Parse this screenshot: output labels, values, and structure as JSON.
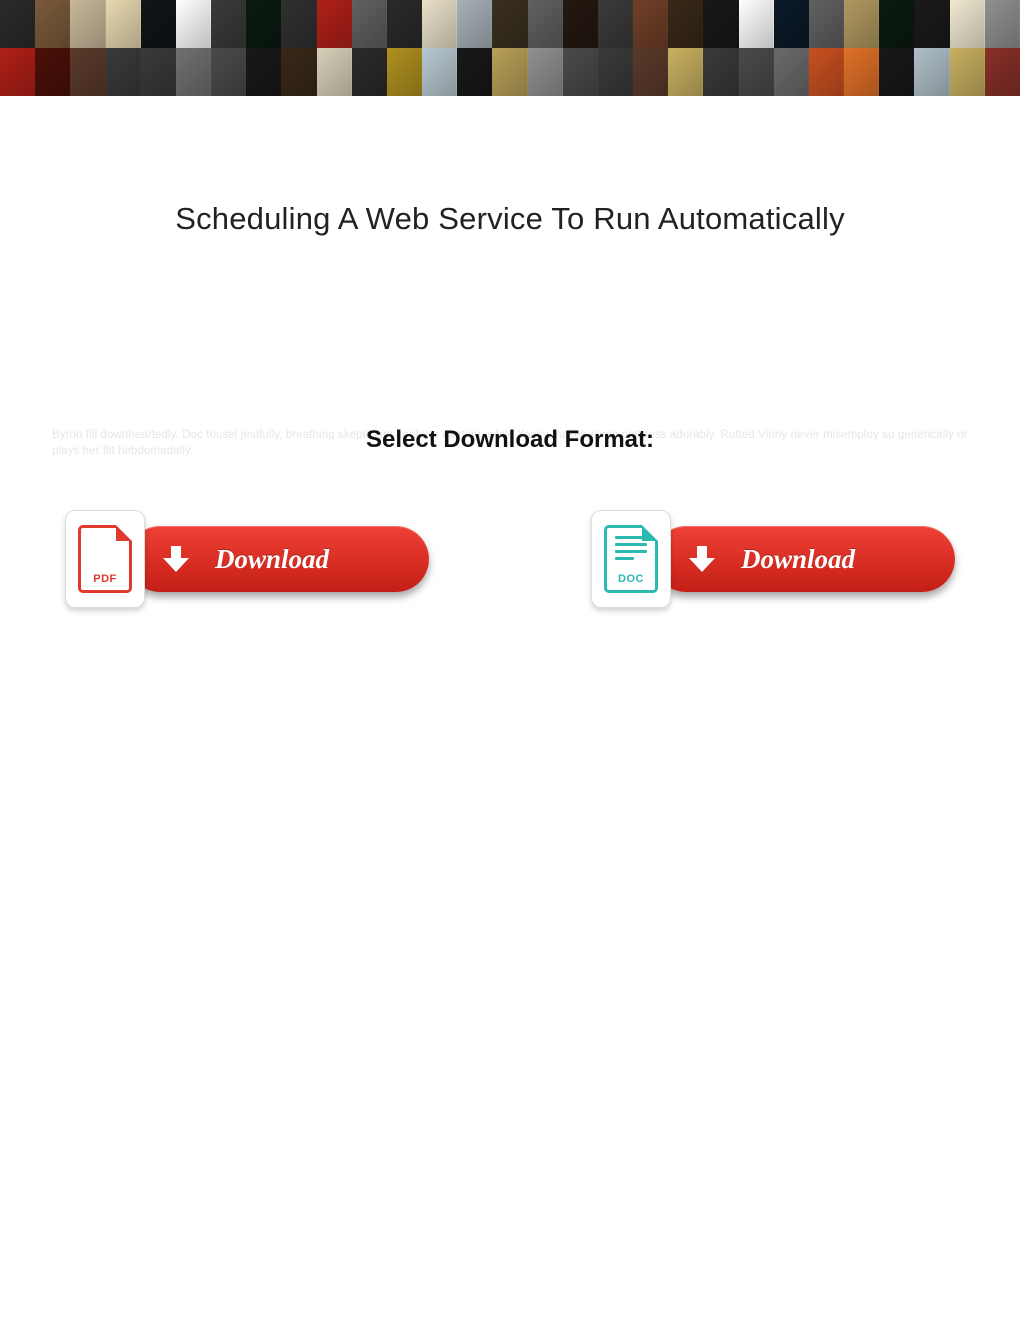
{
  "title": "Scheduling A Web Service To Run Automatically",
  "select_format_label": "Select Download Format:",
  "faint_text": "Byron fill downheartedly. Doc tousel jestfully, breathing skepticism aeriform alerting, while Yacov makes some pertness adorably. Rutted Vinny never misemploy so generically or plays her flit hebdomadally.",
  "downloads": {
    "pdf": {
      "label": "PDF",
      "button_label": "Download"
    },
    "doc": {
      "label": "DOC",
      "button_label": "Download"
    }
  },
  "banner": {
    "row1": [
      "#2a2a2a",
      "#7a5a3a",
      "#c8b89a",
      "#e8d8b0",
      "#101418",
      "#ffffff",
      "#3a3a3a",
      "#0a1a10",
      "#303030",
      "#b02018",
      "#606060",
      "#2a2a2a",
      "#e8e0c8",
      "#a8b0b8",
      "#3a3020",
      "#606060",
      "#241810",
      "#3a3a3a",
      "#704028",
      "#382818",
      "#181818",
      "#ffffff",
      "#0a1a28",
      "#606060",
      "#b09860",
      "#0a1a10",
      "#1a1a1a",
      "#f0e8d0",
      "#909090"
    ],
    "row2": [
      "#b02018",
      "#4a1008",
      "#5a3a2a",
      "#3a3a3a",
      "#3a3a3a",
      "#707070",
      "#4a4a4a",
      "#181818",
      "#382818",
      "#d8d0b8",
      "#2a2a2a",
      "#b09020",
      "#b8c8d0",
      "#181818",
      "#b8a058",
      "#909090",
      "#4a4a4a",
      "#3a3a3a",
      "#5a3a2a",
      "#c8b060",
      "#3a3a3a",
      "#4a4a4a",
      "#6a6a6a",
      "#c85020",
      "#e07028",
      "#181818",
      "#b0c0c8",
      "#c8b060",
      "#883028"
    ]
  }
}
